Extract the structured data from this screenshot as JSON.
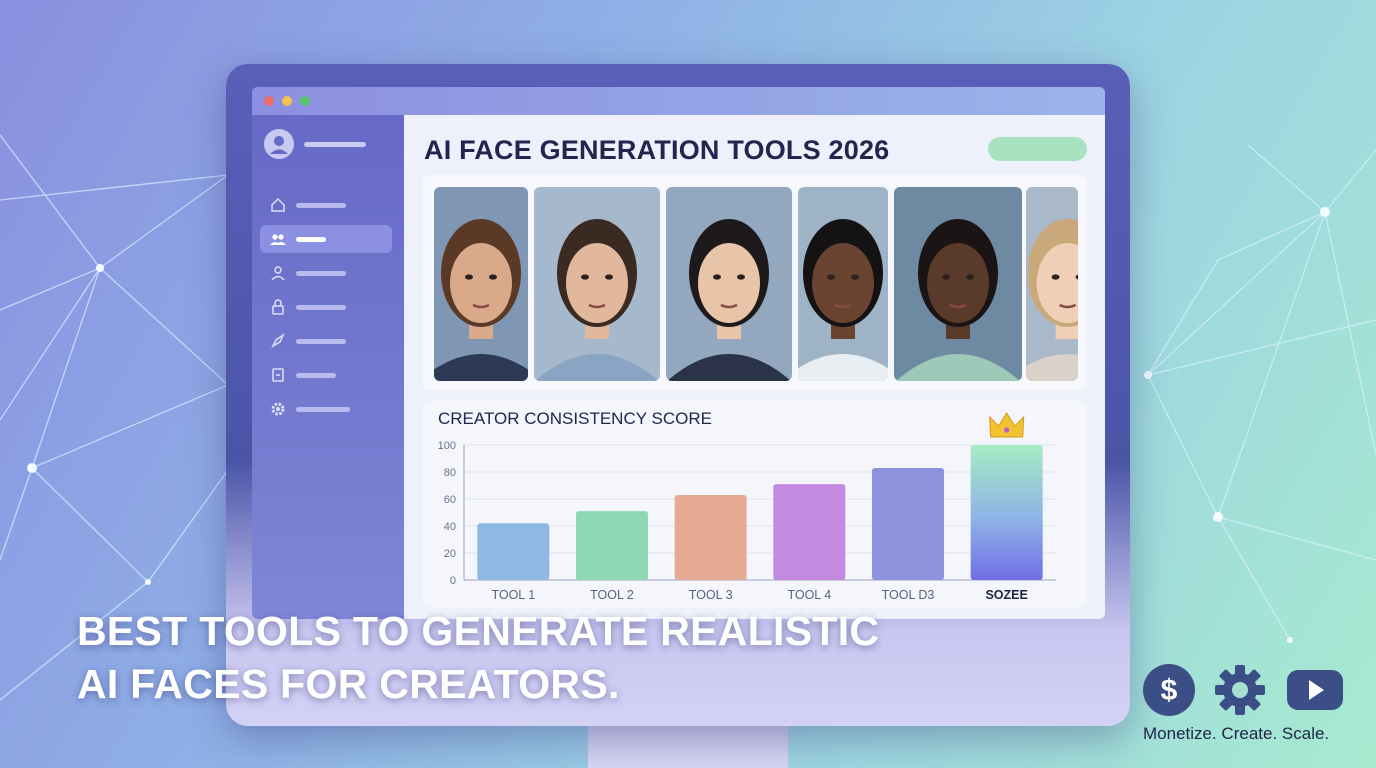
{
  "window": {
    "title": "AI FACE GENERATION TOOLS 2026"
  },
  "sidebar": {
    "items": [
      {
        "icon": "home-icon",
        "active": false
      },
      {
        "icon": "users-icon",
        "active": true
      },
      {
        "icon": "user-icon",
        "active": false
      },
      {
        "icon": "lock-icon",
        "active": false
      },
      {
        "icon": "rocket-icon",
        "active": false
      },
      {
        "icon": "document-icon",
        "active": false
      },
      {
        "icon": "gear-icon",
        "active": false
      }
    ]
  },
  "faces": [
    {
      "skin": "#d9a98a",
      "hair": "#5a3a26",
      "bg": "#7f97b4",
      "shirt": "#2c3a55"
    },
    {
      "skin": "#e2b89c",
      "hair": "#3a2a22",
      "bg": "#a6b8cc",
      "shirt": "#8aa4c4"
    },
    {
      "skin": "#e8c4a8",
      "hair": "#1e1a1c",
      "bg": "#93a8bf",
      "shirt": "#2a3348"
    },
    {
      "skin": "#6a4331",
      "hair": "#141212",
      "bg": "#9fb3c6",
      "shirt": "#e8eef2"
    },
    {
      "skin": "#5a3a2a",
      "hair": "#1a1414",
      "bg": "#6e8aa3",
      "shirt": "#9ec8b8"
    },
    {
      "skin": "#f0cfb6",
      "hair": "#c9a87c",
      "bg": "#a9b9c9",
      "shirt": "#d9d0c8"
    }
  ],
  "chart_data": {
    "type": "bar",
    "title": "CREATOR CONSISTENCY SCORE",
    "categories": [
      "TOOL 1",
      "TOOL 2",
      "TOOL 3",
      "TOOL 4",
      "TOOL D3",
      "SOZEE"
    ],
    "values": [
      42,
      51,
      63,
      71,
      83,
      100
    ],
    "colors": [
      "#8fb8e4",
      "#8fd8b4",
      "#e5ab92",
      "#c38be0",
      "#8c92dc",
      "gradient"
    ],
    "ylim": [
      0,
      100
    ],
    "yticks": [
      0,
      20,
      40,
      60,
      80,
      100
    ],
    "highlight": "SOZEE",
    "grid": true
  },
  "headline": {
    "line1": "BEST TOOLS TO GENERATE REALISTIC",
    "line2": "AI FACES FOR CREATORS."
  },
  "badges": [
    {
      "icon": "dollar-icon"
    },
    {
      "icon": "gear-icon"
    },
    {
      "icon": "youtube-play-icon"
    }
  ],
  "tagline": "Monetize. Create. Scale."
}
